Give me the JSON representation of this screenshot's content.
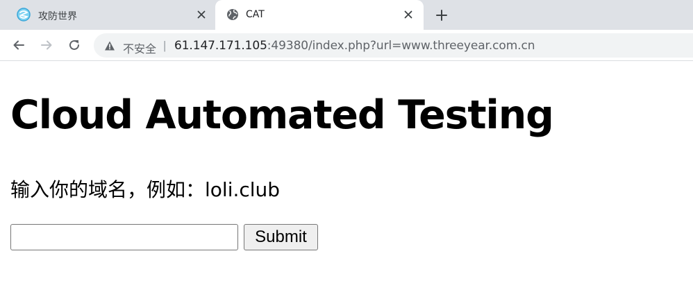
{
  "tabs": [
    {
      "title": "攻防世界",
      "icon": "site-logo-icon"
    },
    {
      "title": "CAT",
      "icon": "globe-icon"
    }
  ],
  "toolbar": {
    "security_label": "不安全",
    "url_host": "61.147.171.105",
    "url_rest": ":49380/index.php?url=www.threeyear.com.cn"
  },
  "page": {
    "heading": "Cloud Automated Testing",
    "prompt": "输入你的域名，例如：loli.club",
    "input_value": "",
    "submit_label": "Submit"
  },
  "colors": {
    "tabstrip": "#dee1e6",
    "omnibox": "#f1f3f4",
    "text_secondary": "#5f6368",
    "text_primary": "#202124"
  }
}
